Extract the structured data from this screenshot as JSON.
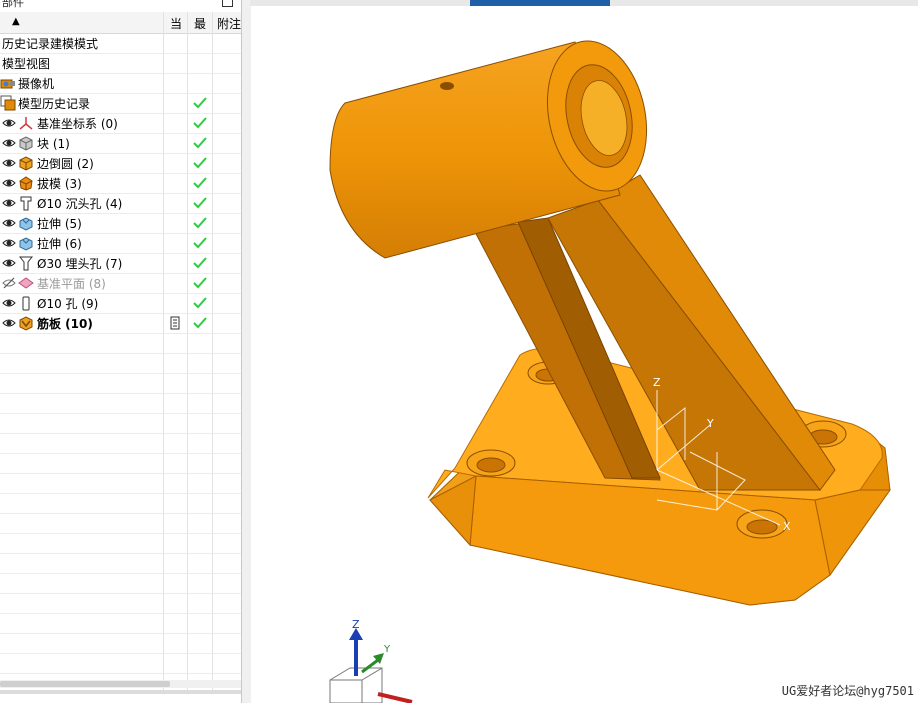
{
  "navigator": {
    "title": "部件",
    "columns": {
      "current": "当",
      "latest": "最",
      "attachment": "附注"
    },
    "items": [
      {
        "label": "历史记录建模模式",
        "icon": "",
        "eye": false,
        "check": false
      },
      {
        "label": "模型视图",
        "icon": "",
        "eye": false,
        "check": false
      },
      {
        "label": "摄像机",
        "icon": "camera-icon",
        "eye": false,
        "check": false
      },
      {
        "label": "模型历史记录",
        "icon": "model-history-icon",
        "eye": false,
        "check": true
      },
      {
        "label": "基准坐标系 (0)",
        "icon": "datum-csys-icon",
        "eye": true,
        "check": true
      },
      {
        "label": "块 (1)",
        "icon": "block-icon",
        "eye": true,
        "check": true
      },
      {
        "label": "边倒圆 (2)",
        "icon": "edge-blend-icon",
        "eye": true,
        "check": true
      },
      {
        "label": "拔模 (3)",
        "icon": "draft-icon",
        "eye": true,
        "check": true
      },
      {
        "label": "Ø10 沉头孔 (4)",
        "icon": "counterbore-hole-icon",
        "eye": true,
        "check": true
      },
      {
        "label": "拉伸 (5)",
        "icon": "extrude-icon",
        "eye": true,
        "check": true
      },
      {
        "label": "拉伸 (6)",
        "icon": "extrude-icon",
        "eye": true,
        "check": true
      },
      {
        "label": "Ø30 埋头孔 (7)",
        "icon": "countersink-hole-icon",
        "eye": true,
        "check": true
      },
      {
        "label": "基准平面 (8)",
        "icon": "datum-plane-icon",
        "eye": "hidden",
        "check": true,
        "dim": true
      },
      {
        "label": "Ø10 孔 (9)",
        "icon": "simple-hole-icon",
        "eye": true,
        "check": true
      },
      {
        "label": "筋板 (10)",
        "icon": "rib-icon",
        "eye": true,
        "check": true,
        "bold": true,
        "attachment": true
      }
    ]
  },
  "viewport": {
    "model_color": "#f29a0a",
    "axis_labels": {
      "z": "Z",
      "y": "Y",
      "x": "X"
    },
    "triad_labels": {
      "z": "Z",
      "y": "Y"
    }
  },
  "watermark": "UG爱好者论坛@hyg7501"
}
